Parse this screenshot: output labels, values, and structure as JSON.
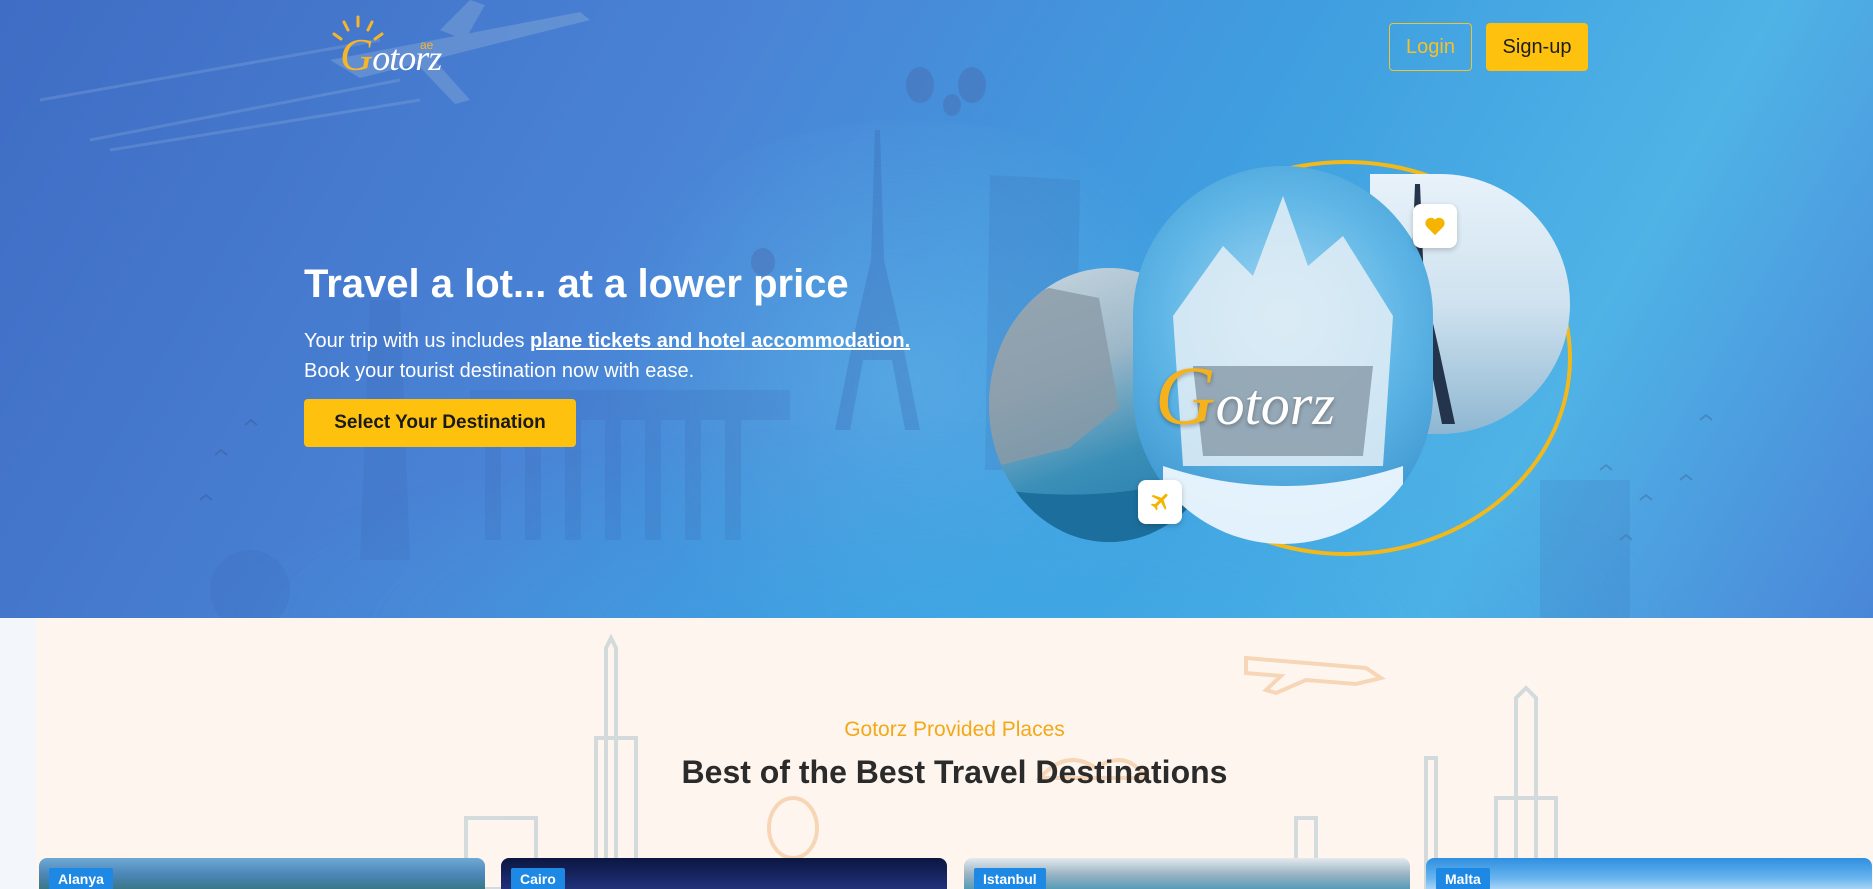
{
  "header": {
    "logo": {
      "brand": "Gotorz",
      "suffix": "ae"
    },
    "login_label": "Login",
    "signup_label": "Sign-up"
  },
  "hero": {
    "title": "Travel a lot... at a lower price",
    "desc_prefix": "Your trip with us includes ",
    "desc_highlight": "plane tickets and hotel accommodation.",
    "desc_line2": "Book your tourist destination now with ease.",
    "cta_label": "Select Your Destination",
    "collage_brand": "Gotorz"
  },
  "destinations": {
    "subtitle": "Gotorz Provided Places",
    "title": "Best of the Best Travel Destinations",
    "cards": [
      {
        "label": "Alanya"
      },
      {
        "label": "Cairo"
      },
      {
        "label": "Istanbul"
      },
      {
        "label": "Malta"
      }
    ]
  },
  "colors": {
    "accent": "#fec10d",
    "hero_blue": "#4a84d6",
    "section_bg": "#fef6ee",
    "tag_blue": "#1e88e5"
  },
  "icons": [
    "heart-icon",
    "airplane-icon",
    "sun-icon"
  ]
}
